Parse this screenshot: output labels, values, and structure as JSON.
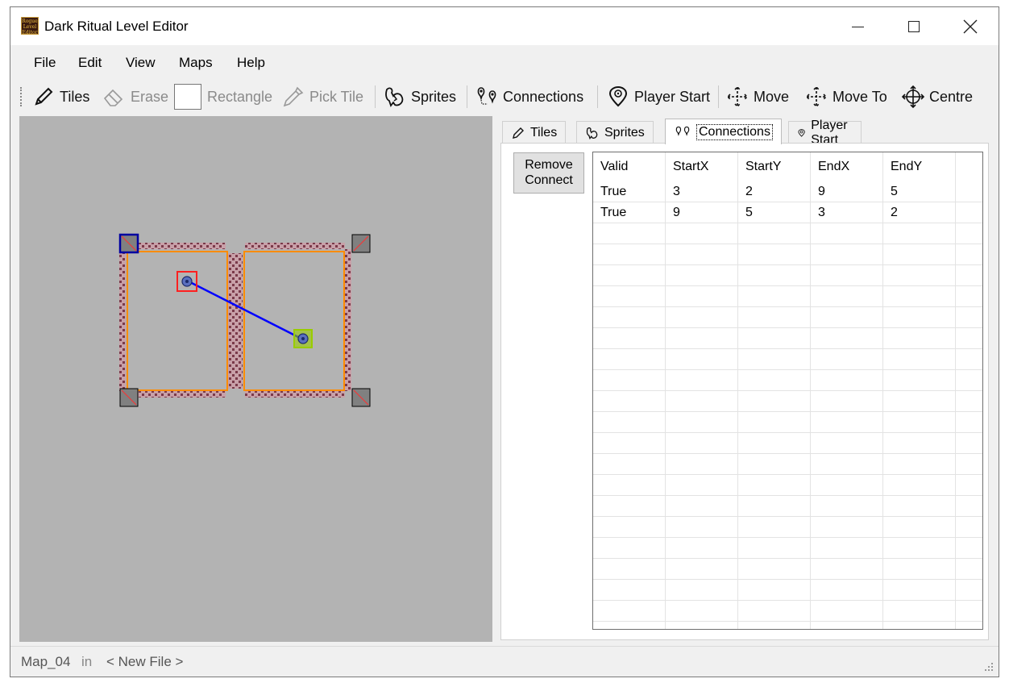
{
  "window": {
    "title": "Dark Ritual Level Editor",
    "icon_text": [
      "Rogue",
      "Level",
      "Editor"
    ]
  },
  "menu": [
    "File",
    "Edit",
    "View",
    "Maps",
    "Help"
  ],
  "toolbar": {
    "tiles": "Tiles",
    "erase": "Erase",
    "rectangle": "Rectangle",
    "pick_tile": "Pick Tile",
    "sprites": "Sprites",
    "connections": "Connections",
    "player_start": "Player Start",
    "move": "Move",
    "move_to": "Move To",
    "centre": "Centre"
  },
  "tabs": {
    "tiles": "Tiles",
    "sprites": "Sprites",
    "connections": "Connections",
    "player_start": "Player Start",
    "active": "Connections"
  },
  "connections_panel": {
    "remove_button": [
      "Remove",
      "Connect"
    ],
    "columns": [
      "Valid",
      "StartX",
      "StartY",
      "EndX",
      "EndY"
    ],
    "rows": [
      [
        "True",
        "3",
        "2",
        "9",
        "5"
      ],
      [
        "True",
        "9",
        "5",
        "3",
        "2"
      ]
    ]
  },
  "status": {
    "map": "Map_04",
    "in": "in",
    "file": "< New File >"
  },
  "colors": {
    "canvas_bg": "#b3b3b3",
    "room_border": "#ff8c00",
    "wall": "#9c5a6a",
    "connection_line": "#0000ff",
    "start_marker": "#ff2020",
    "end_marker": "#99cc00",
    "selected_corner": "#0000a0"
  }
}
